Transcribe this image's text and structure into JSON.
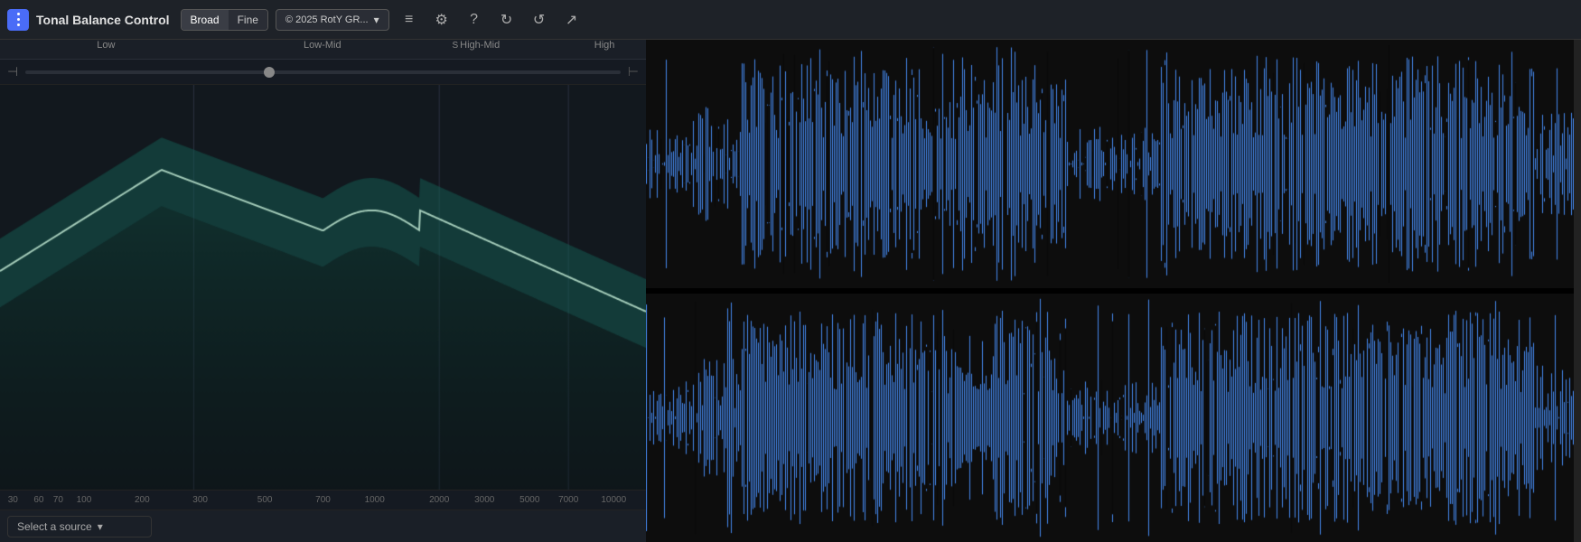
{
  "header": {
    "title": "Tonal Balance Control",
    "menu_icon": "grid-icon",
    "broad_label": "Broad",
    "fine_label": "Fine",
    "source_label": "© 2025 RotY GR...",
    "source_active": true,
    "icons": [
      "hamburger-icon",
      "settings-icon",
      "help-icon",
      "undo-icon",
      "redo-icon",
      "meter-icon"
    ]
  },
  "bands": [
    {
      "label": "Low",
      "left_pct": 15
    },
    {
      "label": "Low-Mid",
      "left_pct": 47
    },
    {
      "label": "High-Mid",
      "left_pct": 73,
      "has_solo": true
    },
    {
      "label": "High",
      "left_pct": 93
    }
  ],
  "dividers": [
    {
      "left_pct": 30
    },
    {
      "left_pct": 68
    },
    {
      "left_pct": 88
    }
  ],
  "freq_labels": [
    {
      "label": "30",
      "left_pct": 2
    },
    {
      "label": "60",
      "left_pct": 7
    },
    {
      "label": "70",
      "left_pct": 9
    },
    {
      "label": "100",
      "left_pct": 13
    },
    {
      "label": "200",
      "left_pct": 22
    },
    {
      "label": "300",
      "left_pct": 30
    },
    {
      "label": "500",
      "left_pct": 41
    },
    {
      "label": "700",
      "left_pct": 50
    },
    {
      "label": "1000",
      "left_pct": 58
    },
    {
      "label": "2000",
      "left_pct": 68
    },
    {
      "label": "3000",
      "left_pct": 74
    },
    {
      "label": "5000",
      "left_pct": 81
    },
    {
      "label": "7000",
      "left_pct": 87
    },
    {
      "label": "10000",
      "left_pct": 94
    }
  ],
  "bottom": {
    "select_source_label": "Select a source",
    "dropdown_arrow": "▾"
  },
  "colors": {
    "accent": "#4a9e8a",
    "band_fill": "#1a4a42",
    "waveform_blue": "#4488ee",
    "waveform_dark": "#0d0d0d",
    "header_bg": "#1e2228",
    "panel_bg": "#12181e"
  }
}
